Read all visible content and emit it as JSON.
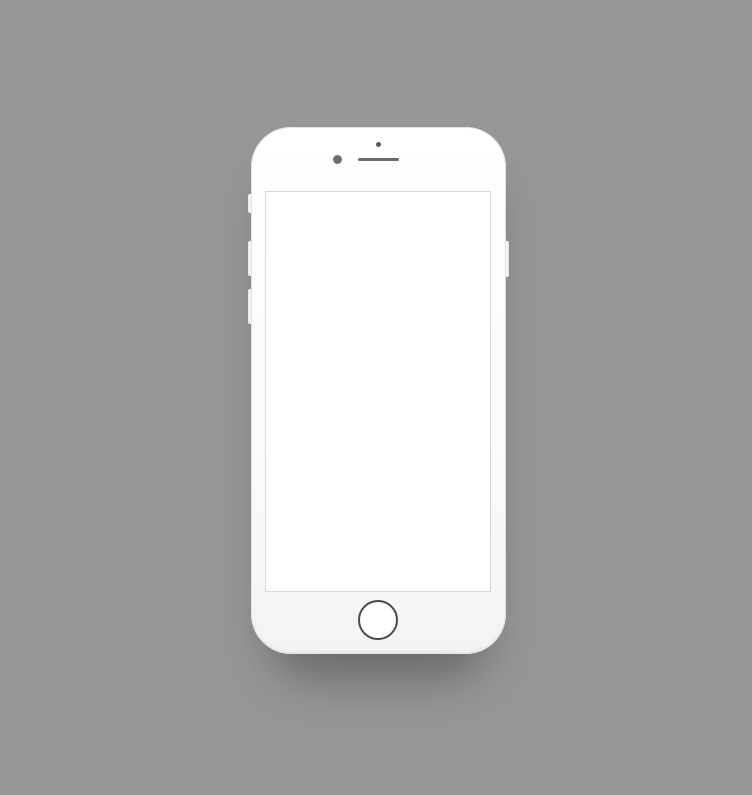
{
  "device": {
    "model": "smartphone",
    "color": "#ffffff",
    "background_color": "#969696",
    "screen_color": "#ffffff",
    "icons": {
      "camera": "front-camera-icon",
      "speaker": "earpiece-icon",
      "home": "home-button-icon"
    }
  },
  "screen": {
    "content": ""
  }
}
